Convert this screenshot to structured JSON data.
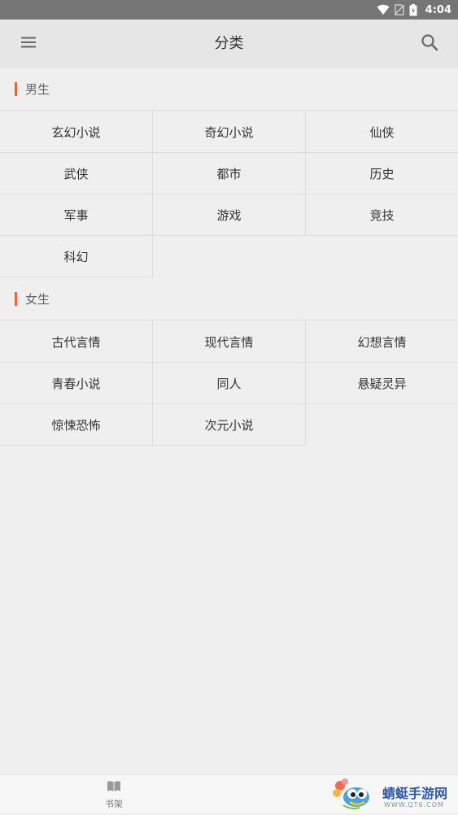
{
  "status_bar": {
    "time": "4:04",
    "icons": [
      "wifi-icon",
      "no-sim-icon",
      "battery-icon"
    ]
  },
  "app_bar": {
    "title": "分类",
    "menu_icon": "hamburger-menu-icon",
    "search_icon": "search-icon"
  },
  "sections": [
    {
      "title": "男生",
      "accent_color": "#e8653a",
      "items": [
        "玄幻小说",
        "奇幻小说",
        "仙侠",
        "武侠",
        "都市",
        "历史",
        "军事",
        "游戏",
        "竞技",
        "科幻"
      ]
    },
    {
      "title": "女生",
      "accent_color": "#e8653a",
      "items": [
        "古代言情",
        "现代言情",
        "幻想言情",
        "青春小说",
        "同人",
        "悬疑灵异",
        "惊悚恐怖",
        "次元小说"
      ]
    }
  ],
  "bottom_nav": {
    "bookshelf_label": "书架",
    "bookshelf_icon": "book-icon"
  },
  "watermark": {
    "text": "蜻蜓手游网",
    "url": "WWW.QT6.COM"
  }
}
